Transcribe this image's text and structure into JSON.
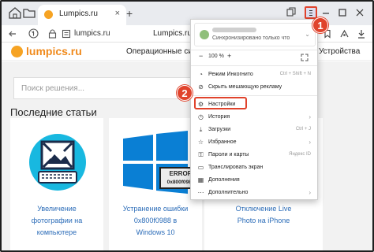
{
  "browser": {
    "tab_title": "Lumpics.ru",
    "tab_close": "×",
    "new_tab": "+",
    "url": "lumpics.ru",
    "page_title": "Lumpics.ru"
  },
  "site": {
    "logo": "lumpics.ru",
    "nav_os": "Операционные систе",
    "nav_devices": "Устройства",
    "search_placeholder": "Поиск решения...",
    "section_title": "Последние статьи",
    "cards": [
      {
        "caption_lines": [
          "Увеличение",
          "фотографии на",
          "компьютере"
        ]
      },
      {
        "caption_lines": [
          "Устранение ошибки",
          "0x800f0988 в",
          "Windows 10"
        ],
        "error_title": "ERROR",
        "error_code": "0x800f0988"
      },
      {
        "caption_lines": [
          "Отключение Live",
          "Photo на iPhone"
        ]
      }
    ]
  },
  "menu": {
    "sync_status": "Синхронизировано только что",
    "zoom_minus": "−",
    "zoom_value": "100 %",
    "zoom_plus": "+",
    "items": [
      {
        "label": "Режим Инкогнито",
        "shortcut": "Ctrl + Shift + N",
        "icon": "incognito-icon"
      },
      {
        "label": "Скрыть мешающую рекламу",
        "shortcut": "",
        "icon": "block-icon"
      },
      {
        "label": "Настройки",
        "shortcut": "",
        "icon": "gear-icon"
      },
      {
        "label": "История",
        "shortcut": "",
        "icon": "history-icon",
        "arrow": true
      },
      {
        "label": "Загрузки",
        "shortcut": "Ctrl + J",
        "icon": "download-icon"
      },
      {
        "label": "Избранное",
        "shortcut": "",
        "icon": "star-icon",
        "arrow": true
      },
      {
        "label": "Пароли и карты",
        "shortcut": "Яндекс ID",
        "icon": "key-icon"
      },
      {
        "label": "Транслировать экран",
        "shortcut": "",
        "icon": "cast-icon"
      },
      {
        "label": "Дополнения",
        "shortcut": "",
        "icon": "addons-icon"
      },
      {
        "label": "Дополнительно",
        "shortcut": "",
        "icon": "more-icon",
        "arrow": true
      }
    ]
  },
  "callouts": {
    "one": "1",
    "two": "2"
  },
  "colors": {
    "accent": "#e0432c",
    "brand": "#f08a1c",
    "link": "#2b6cb8"
  }
}
